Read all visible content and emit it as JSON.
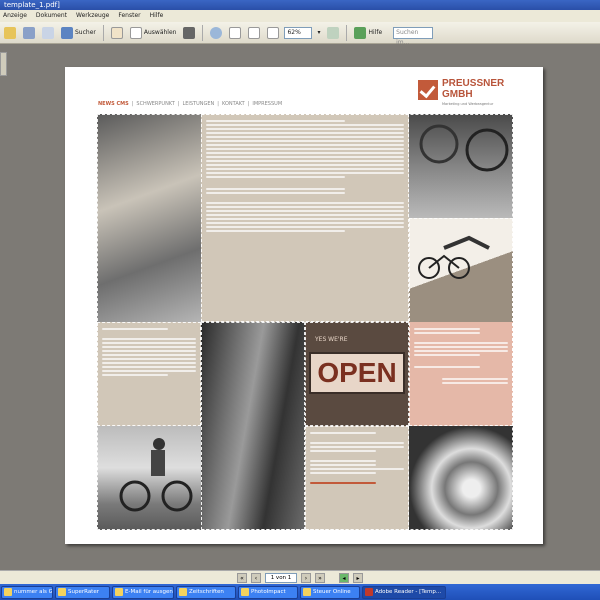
{
  "window": {
    "title": "template_1.pdf]"
  },
  "menu": [
    "Anzeige",
    "Dokument",
    "Werkzeuge",
    "Fenster",
    "Hilfe"
  ],
  "toolbar": {
    "save_label": "Sucher",
    "select_label": "Auswählen",
    "zoom_value": "62%",
    "help_label": "Hilfe",
    "search_placeholder": "Suchen im..."
  },
  "pdf_page": {
    "brand_name_line1": "PREUSSNER",
    "brand_name_line2": "GMBH",
    "brand_tagline": "Marketing und Werbeagentur",
    "nav_items": [
      "NEWS CMS",
      "SCHWERPUNKT",
      "LEISTUNGEN",
      "KONTAKT",
      "IMPRESSUM"
    ],
    "accent_color": "#c25a3a",
    "sign_text": "OPEN",
    "sign_top": "YES WE'RE"
  },
  "statusbar": {
    "page_indicator": "1 von 1"
  },
  "taskbar": [
    {
      "label": "nummer als Gu...",
      "active": false
    },
    {
      "label": "SuperRater",
      "active": false
    },
    {
      "label": "E-Mail für ausgenommen...",
      "active": false
    },
    {
      "label": "Zeitschriften",
      "active": false
    },
    {
      "label": "PhotoImpact",
      "active": false
    },
    {
      "label": "Steuer Online",
      "active": false
    },
    {
      "label": "Adobe Reader - [Temp...",
      "active": true
    }
  ]
}
